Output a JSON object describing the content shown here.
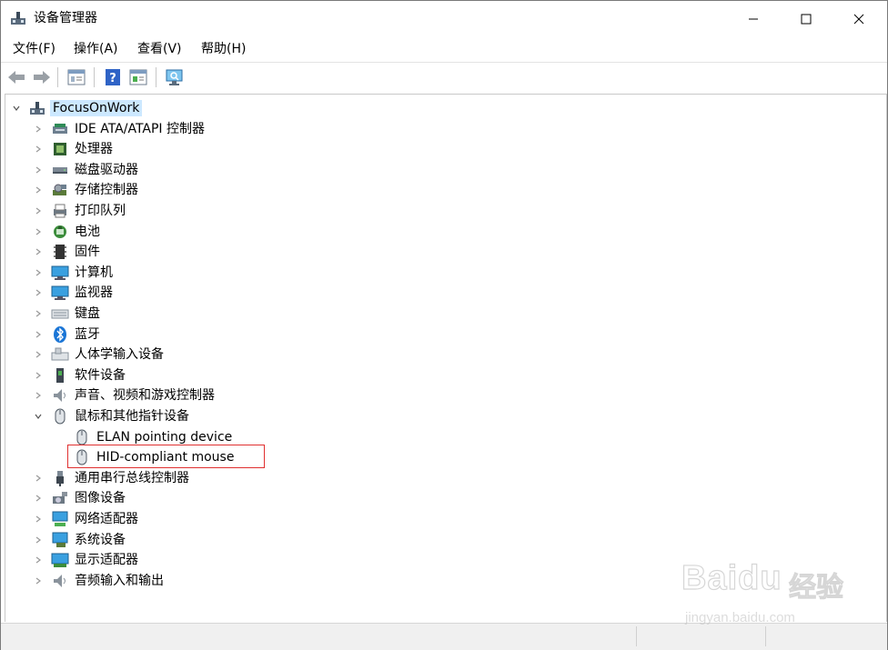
{
  "window": {
    "title": "设备管理器"
  },
  "menu": [
    "文件(F)",
    "操作(A)",
    "查看(V)",
    "帮助(H)"
  ],
  "toolbar": {
    "buttons": [
      "back-icon",
      "forward-icon",
      "properties-icon",
      "help-icon",
      "view-icon",
      "scan-hardware-icon"
    ]
  },
  "tree": {
    "root": "FocusOnWork",
    "categories": [
      {
        "label": "IDE ATA/ATAPI 控制器",
        "icon": "ide-controller-icon"
      },
      {
        "label": "处理器",
        "icon": "processor-icon"
      },
      {
        "label": "磁盘驱动器",
        "icon": "disk-drive-icon"
      },
      {
        "label": "存储控制器",
        "icon": "storage-controller-icon"
      },
      {
        "label": "打印队列",
        "icon": "print-queue-icon"
      },
      {
        "label": "电池",
        "icon": "battery-icon"
      },
      {
        "label": "固件",
        "icon": "firmware-icon"
      },
      {
        "label": "计算机",
        "icon": "computer-icon"
      },
      {
        "label": "监视器",
        "icon": "monitor-icon"
      },
      {
        "label": "键盘",
        "icon": "keyboard-icon"
      },
      {
        "label": "蓝牙",
        "icon": "bluetooth-icon"
      },
      {
        "label": "人体学输入设备",
        "icon": "hid-icon"
      },
      {
        "label": "软件设备",
        "icon": "software-device-icon"
      },
      {
        "label": "声音、视频和游戏控制器",
        "icon": "sound-icon"
      },
      {
        "label": "鼠标和其他指针设备",
        "icon": "mouse-icon",
        "expanded": true,
        "children": [
          "ELAN pointing device",
          "HID-compliant mouse"
        ]
      },
      {
        "label": "通用串行总线控制器",
        "icon": "usb-icon"
      },
      {
        "label": "图像设备",
        "icon": "imaging-icon"
      },
      {
        "label": "网络适配器",
        "icon": "network-adapter-icon"
      },
      {
        "label": "系统设备",
        "icon": "system-device-icon"
      },
      {
        "label": "显示适配器",
        "icon": "display-adapter-icon"
      },
      {
        "label": "音频输入和输出",
        "icon": "audio-io-icon"
      }
    ],
    "highlighted_child": "HID-compliant mouse"
  },
  "watermark": {
    "brand": "Baidu",
    "cn": "经验",
    "url": "jingyan.baidu.com"
  },
  "colors": {
    "selection": "#cce8ff",
    "highlight_border": "#e03030",
    "accent_blue": "#1e6fd9"
  }
}
